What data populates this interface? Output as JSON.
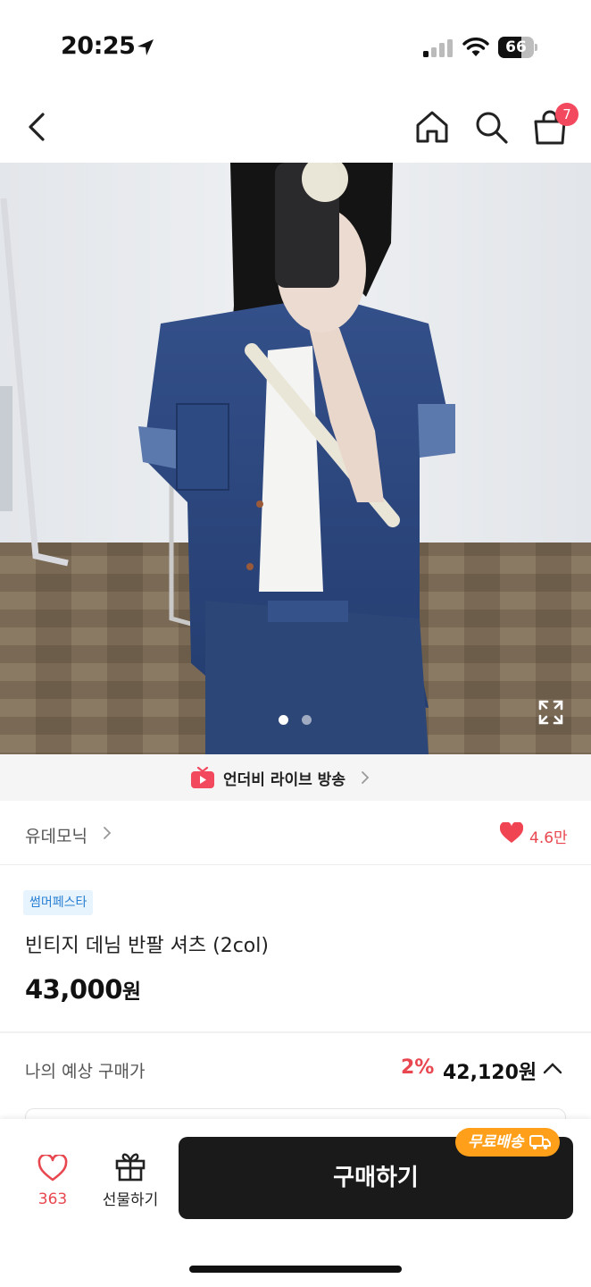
{
  "status_bar": {
    "time": "20:25",
    "battery_level": 66,
    "battery_label": "66"
  },
  "nav": {
    "cart_count": "7"
  },
  "gallery": {
    "current_index": 1,
    "total_images": 2
  },
  "live_banner": {
    "label": "언더비 라이브 방송"
  },
  "brand": {
    "name": "유데모닉",
    "likes": "4.6만"
  },
  "product": {
    "promo_tag": "썸머페스타",
    "title": "빈티지 데님 반팔 셔츠 (2col)",
    "price": "43,000",
    "price_unit": "원"
  },
  "expected_price": {
    "label": "나의 예상 구매가",
    "discount": "2%",
    "price": "42,120원"
  },
  "bottom_bar": {
    "wish_count": "363",
    "gift_label": "선물하기",
    "buy_label": "구매하기",
    "free_shipping_label": "무료배송"
  },
  "colors": {
    "accent_red": "#e8474f",
    "badge_red": "#f2495e",
    "buy_button": "#1a1a1a",
    "free_shipping": "#ff9f1a",
    "promo_tag_text": "#2a80d4"
  },
  "icons": [
    "back-arrow-icon",
    "home-icon",
    "search-icon",
    "cart-icon",
    "expand-icon",
    "live-tv-icon",
    "heart-icon",
    "gift-icon",
    "truck-icon"
  ]
}
